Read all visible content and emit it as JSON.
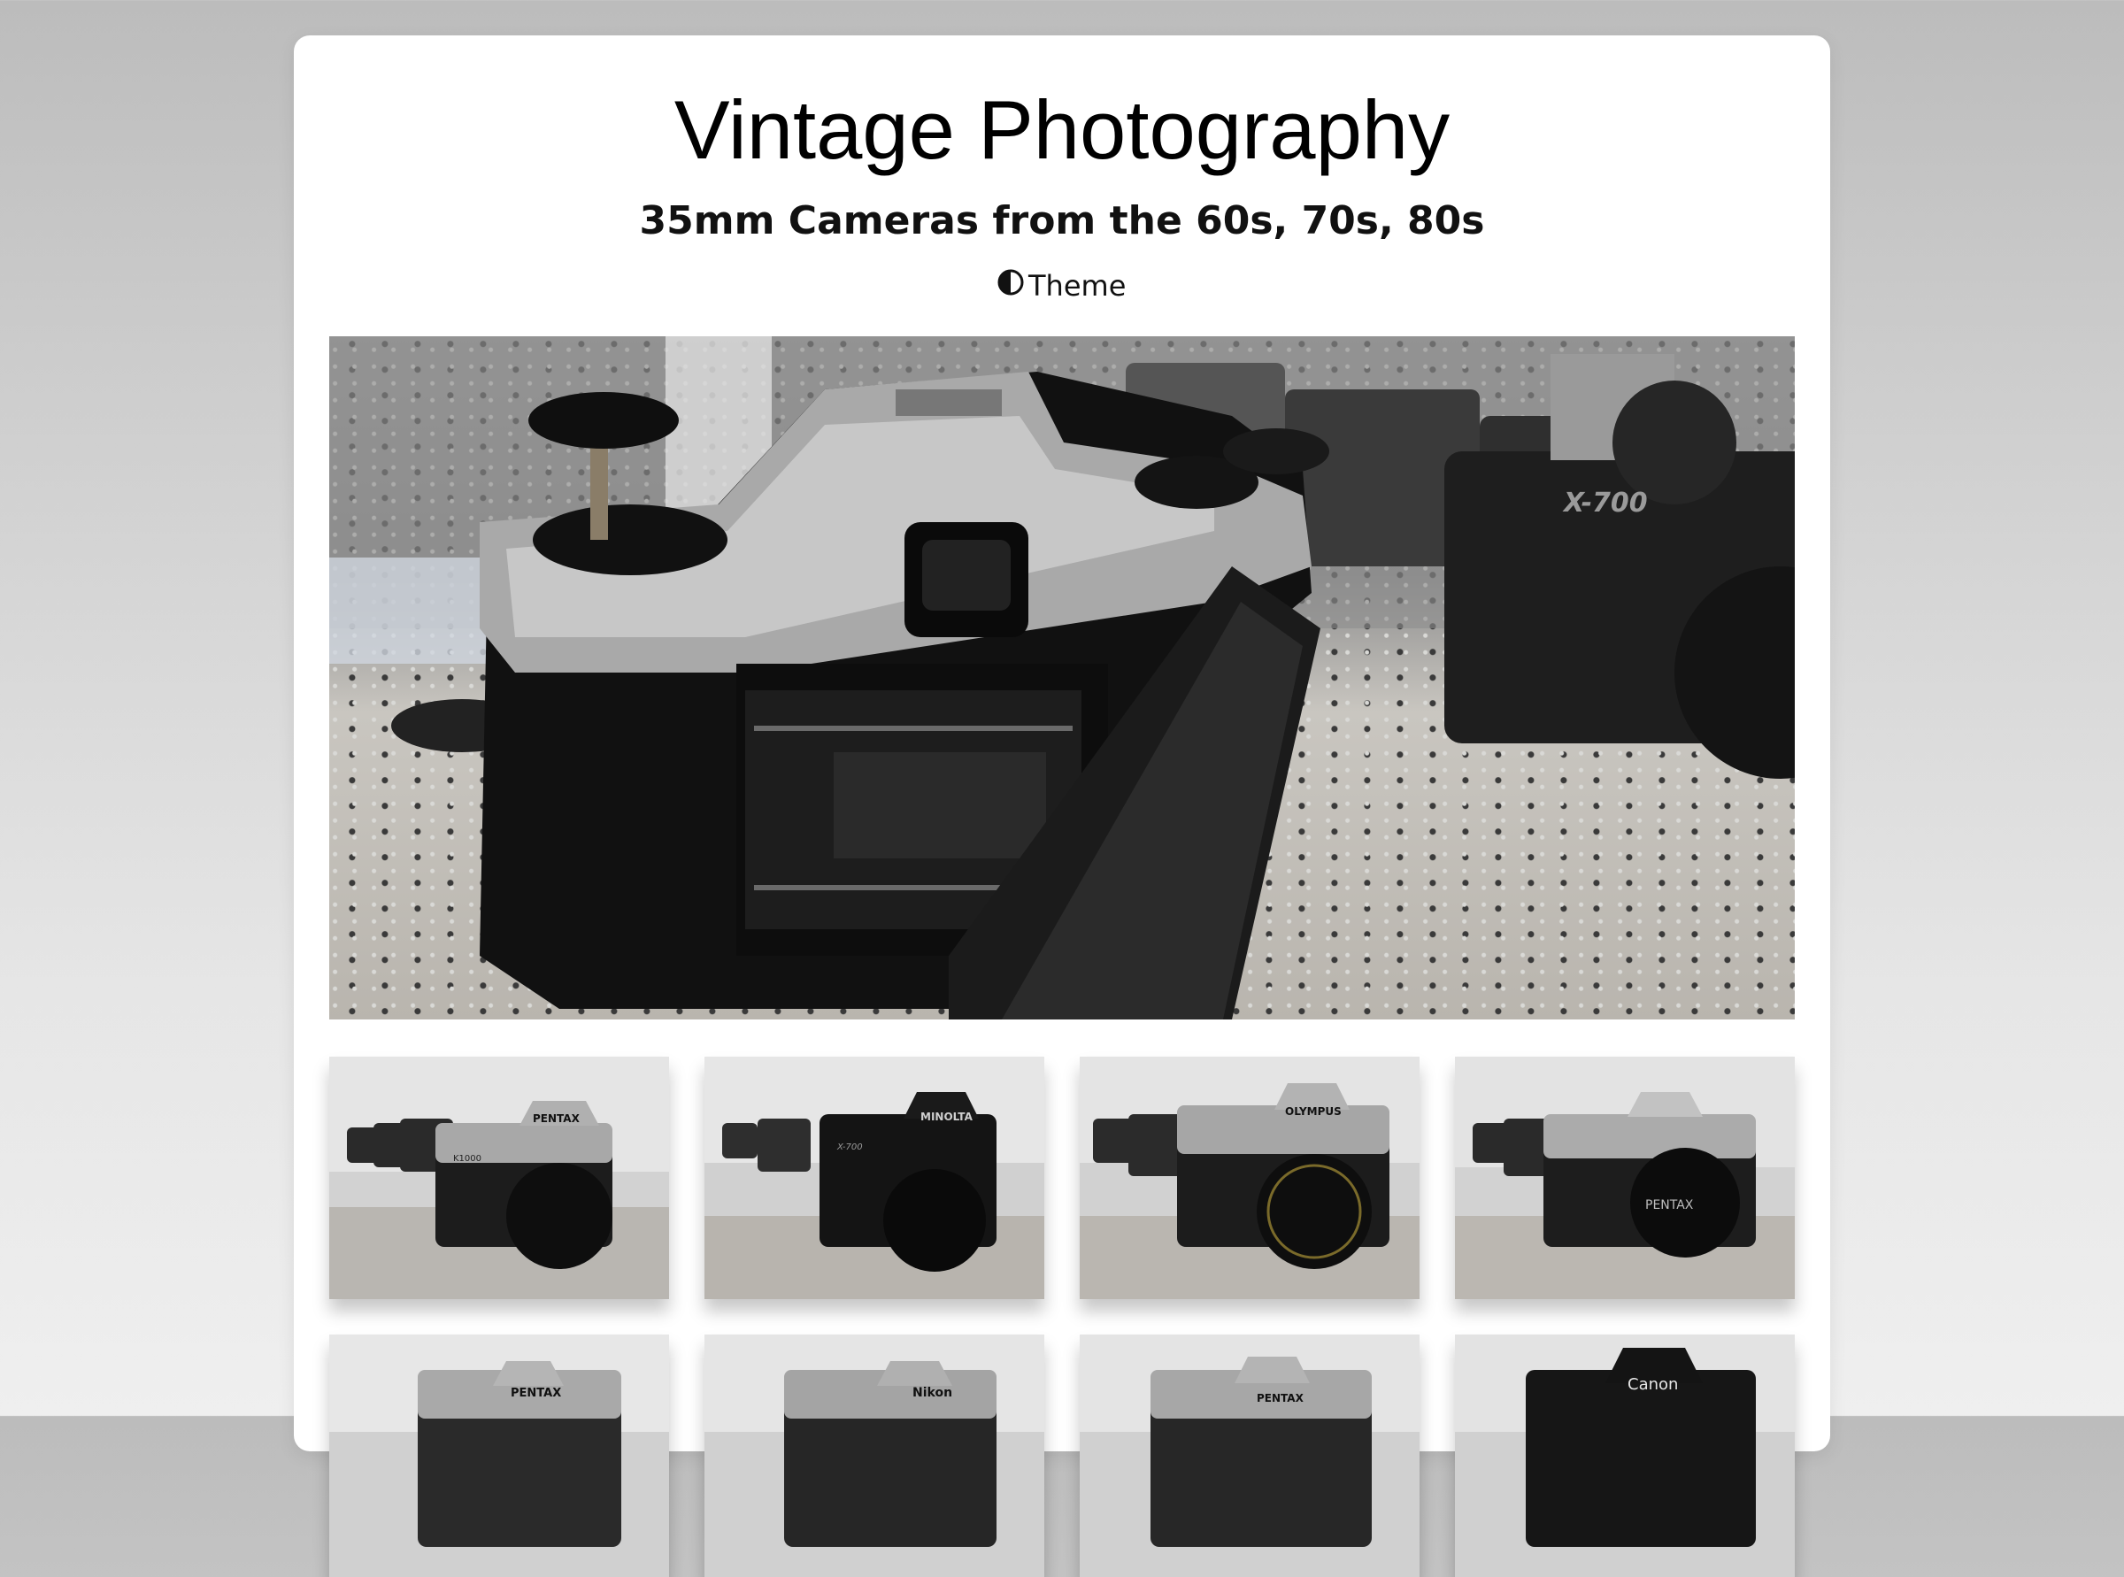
{
  "header": {
    "title": "Vintage Photography",
    "subtitle": "35mm Cameras from the 60s, 70s, 80s",
    "theme_label": "Theme",
    "theme_icon": "half-circle-contrast-icon"
  },
  "hero": {
    "subject": "open-back-slr-camera-photo",
    "visible_text": [
      "X-700"
    ]
  },
  "gallery": {
    "thumbnails": [
      {
        "brand_text": "PENTAX",
        "model_text": "K1000"
      },
      {
        "brand_text": "MINOLTA",
        "model_text": "X-700"
      },
      {
        "brand_text": "OLYMPUS",
        "model_text": ""
      },
      {
        "brand_text": "PENTAX",
        "model_text": ""
      },
      {
        "brand_text": "PENTAX",
        "model_text": ""
      },
      {
        "brand_text": "Nikon",
        "model_text": ""
      },
      {
        "brand_text": "PENTAX",
        "model_text": ""
      },
      {
        "brand_text": "Canon",
        "model_text": ""
      }
    ]
  },
  "colors": {
    "page_background_top": "#bcbcbc",
    "page_background_bottom": "#efefef",
    "card_background": "#ffffff",
    "text": "#111111"
  }
}
